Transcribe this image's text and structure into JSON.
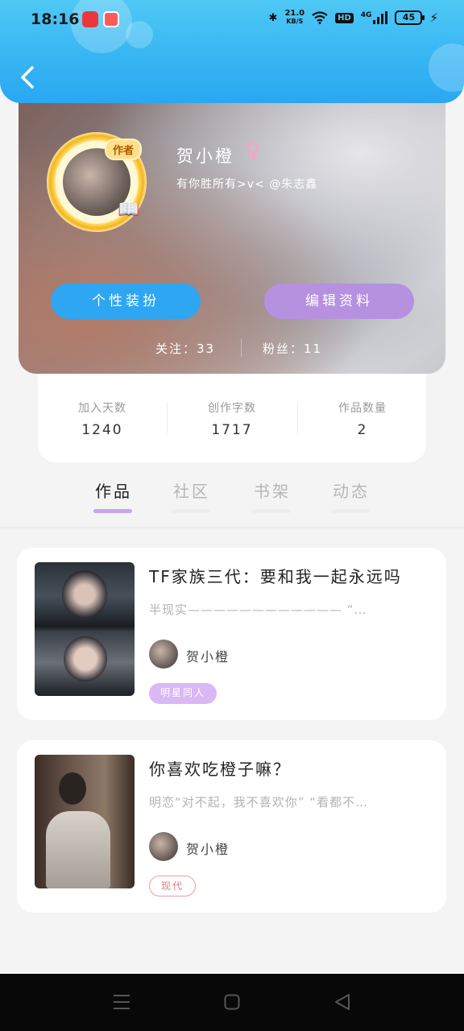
{
  "status": {
    "time": "18:16",
    "speed_value": "21.0",
    "speed_unit": "KB/S",
    "hd": "HD",
    "network": "4G",
    "battery": "45"
  },
  "profile": {
    "author_tag": "作者",
    "name": "贺小橙",
    "gender_symbol": "♀",
    "bio": "有你胜所有>v< @朱志鑫",
    "dress_button": "个性装扮",
    "edit_button": "编辑资料",
    "following": "关注：33",
    "followers": "粉丝：11"
  },
  "stats": [
    {
      "label": "加入天数",
      "value": "1240"
    },
    {
      "label": "创作字数",
      "value": "1717"
    },
    {
      "label": "作品数量",
      "value": "2"
    }
  ],
  "tabs": [
    "作品",
    "社区",
    "书架",
    "动态"
  ],
  "works": [
    {
      "title": "TF家族三代：要和我一起永远吗",
      "desc": "半现实———————————— “…",
      "author": "贺小橙",
      "tag": "明星同人",
      "tag_bg": "#d9b8f3",
      "tag_color": "#ffffff"
    },
    {
      "title": "你喜欢吃橙子嘛？",
      "desc": "明恋“对不起，我不喜欢你” “看都不…",
      "author": "贺小橙",
      "tag": "现代",
      "tag_bg": "#ffffff",
      "tag_color": "#e07a7a"
    }
  ],
  "colors": {
    "header": "#35b4f3",
    "accent_blue": "#2ea6f2",
    "accent_purple": "#b591e0"
  },
  "icons": [
    "back-arrow-icon",
    "bluetooth-icon",
    "wifi-icon",
    "signal-icon",
    "battery-icon",
    "charging-icon",
    "menu-icon",
    "home-icon",
    "back-triangle-icon"
  ]
}
